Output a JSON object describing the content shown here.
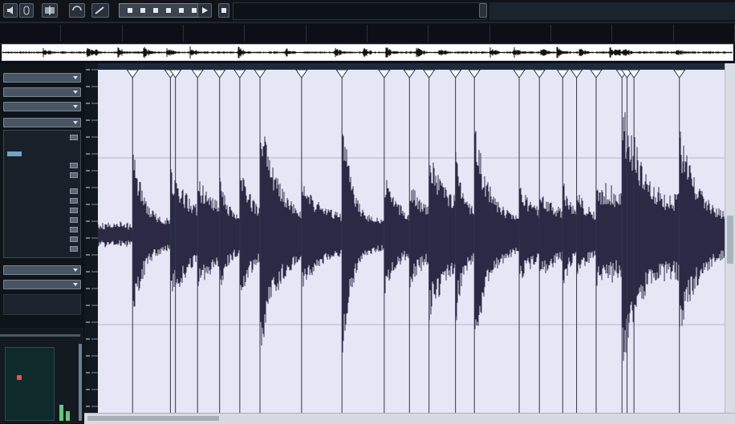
{
  "toolbar": {
    "buttons": [
      "speaker-icon",
      "mouse-icon",
      "split-icon",
      "loop-icon",
      "pencil-icon",
      "zoom-icon",
      "play-icon",
      "stop-icon",
      "record-icon"
    ]
  },
  "info_bar": {
    "cells": [
      {
        "label": "",
        "value": ""
      },
      {
        "label": "",
        "value": ""
      },
      {
        "label": "",
        "value": ""
      },
      {
        "label": "",
        "value": ""
      },
      {
        "label": "",
        "value": ""
      },
      {
        "label": "",
        "value": ""
      },
      {
        "label": "",
        "value": ""
      },
      {
        "label": "",
        "value": ""
      },
      {
        "label": "",
        "value": ""
      },
      {
        "label": "",
        "value": ""
      },
      {
        "label": "",
        "value": ""
      },
      {
        "label": "",
        "value": ""
      }
    ]
  },
  "left_panel": {
    "sections": [
      "",
      "",
      "",
      ""
    ],
    "params": [
      "",
      "",
      "",
      "",
      "",
      "",
      "",
      ""
    ],
    "lower_sections": [
      "",
      ""
    ]
  },
  "waveform": {
    "hitpoints": [
      0.055,
      0.115,
      0.123,
      0.158,
      0.193,
      0.225,
      0.257,
      0.323,
      0.387,
      0.454,
      0.494,
      0.525,
      0.567,
      0.597,
      0.668,
      0.7,
      0.737,
      0.759,
      0.79,
      0.831,
      0.839,
      0.85,
      0.922
    ],
    "colors": {
      "wave": "#2a2a44",
      "marker": "#30364a",
      "background": "#e5e6f6",
      "header": "#1c2b3c"
    }
  }
}
